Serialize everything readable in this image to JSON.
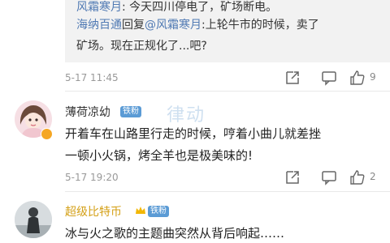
{
  "quote": {
    "line1_user": "风霜寒月",
    "line1_text": ": 今天四川停电了，矿场断电。",
    "line2_user": "海纳百通",
    "line2_mid": "回复",
    "line2_mention": "@风霜寒月",
    "line2_text": ":上轮牛市的时候，卖了",
    "line3_text": "矿场。现在正规化了...吧?"
  },
  "comments": [
    {
      "time": "5-17 11:45",
      "likes": "9"
    },
    {
      "username": "薄荷凉幼",
      "badge": "铁粉",
      "text_line1": "开着车在山路里行走的时候，哼着小曲儿就差挫",
      "text_line2": "一顿小火锅，烤全羊也是极美味的!",
      "time": "5-17 19:20",
      "likes": "2"
    },
    {
      "username": "超级比特币",
      "badge": "铁粉",
      "text_line1": "冰与火之歌的主题曲突然从背后响起……"
    }
  ],
  "watermark": "律动",
  "icons": [
    "share-icon",
    "comment-icon",
    "like-icon",
    "avatar",
    "crown-icon",
    "verified-icon"
  ],
  "colors": {
    "link": "#4f79b3",
    "gold": "#d4a017",
    "badge": "#5b9bd5"
  }
}
